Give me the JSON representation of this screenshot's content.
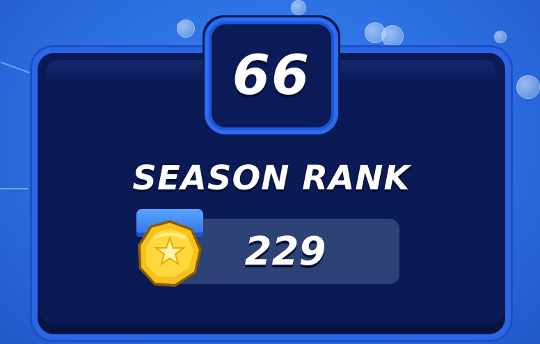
{
  "level": {
    "value": "66"
  },
  "season_rank": {
    "title": "SEASON RANK",
    "value": "229",
    "icon": "gold-star-medal-icon"
  },
  "colors": {
    "background": "#2c6fe0",
    "panel": "#0a1a55",
    "accent": "#2c6cf0",
    "medal": "#f5c21b"
  }
}
